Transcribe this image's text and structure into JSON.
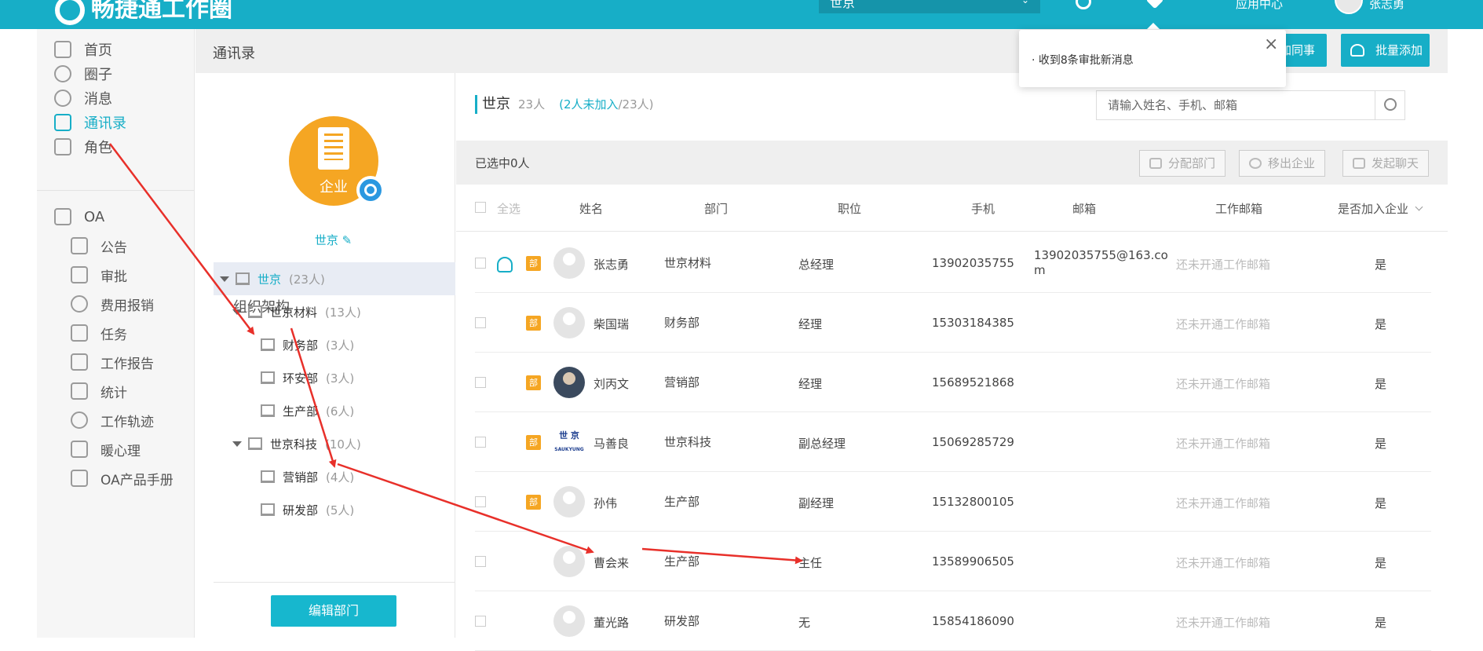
{
  "topbar": {
    "logo_text": "畅捷通工作圈",
    "select_value": "世京",
    "menu_label": "应用中心",
    "user_name": "张志勇"
  },
  "sidebar": {
    "items": [
      {
        "label": "首页"
      },
      {
        "label": "圈子"
      },
      {
        "label": "消息"
      },
      {
        "label": "通讯录"
      },
      {
        "label": "角色"
      }
    ],
    "oa_label": "OA",
    "oa_items": [
      {
        "label": "公告"
      },
      {
        "label": "审批"
      },
      {
        "label": "费用报销"
      },
      {
        "label": "任务"
      },
      {
        "label": "工作报告"
      },
      {
        "label": "统计"
      },
      {
        "label": "工作轨迹"
      },
      {
        "label": "暖心理"
      },
      {
        "label": "OA产品手册"
      }
    ]
  },
  "page": {
    "title": "通讯录"
  },
  "buttons": {
    "add_colleague": "加同事",
    "batch_add": "批量添加"
  },
  "notification": {
    "text": "· 收到8条审批新消息",
    "close": "×"
  },
  "org": {
    "logo_label": "企业",
    "company_name": "世京",
    "section_title": "组织架构",
    "tree": [
      {
        "label": "世京",
        "count": "(23人)"
      },
      {
        "label": "世京材料",
        "count": "(13人)"
      },
      {
        "label": "财务部",
        "count": "(3人)"
      },
      {
        "label": "环安部",
        "count": "(3人)"
      },
      {
        "label": "生产部",
        "count": "(6人)"
      },
      {
        "label": "世京科技",
        "count": "(10人)"
      },
      {
        "label": "营销部",
        "count": "(4人)"
      },
      {
        "label": "研发部",
        "count": "(5人)"
      }
    ],
    "edit_button": "编辑部门"
  },
  "list": {
    "company": "世京",
    "member_count": "23人",
    "not_joined": "(2人未加入",
    "total": "/23人)",
    "search_placeholder": "请输入姓名、手机、邮箱",
    "selected": "已选中0人",
    "actions": {
      "assign": "分配部门",
      "remove": "移出企业",
      "chat": "发起聊天"
    },
    "headers": {
      "select_all": "全选",
      "name": "姓名",
      "dept": "部门",
      "position": "职位",
      "phone": "手机",
      "email": "邮箱",
      "work_email": "工作邮箱",
      "joined": "是否加入企业"
    },
    "dept_badge": "部",
    "rows": [
      {
        "name": "张志勇",
        "dept": "世京材料",
        "position": "总经理",
        "phone": "13902035755",
        "email": "13902035755@163.co",
        "email2": "m",
        "work_email": "还未开通工作邮箱",
        "joined": "是"
      },
      {
        "name": "柴国瑞",
        "dept": "财务部",
        "position": "经理",
        "phone": "15303184385",
        "email": "",
        "email2": "",
        "work_email": "还未开通工作邮箱",
        "joined": "是"
      },
      {
        "name": "刘丙文",
        "dept": "营销部",
        "position": "经理",
        "phone": "15689521868",
        "email": "",
        "email2": "",
        "work_email": "还未开通工作邮箱",
        "joined": "是"
      },
      {
        "name": "马善良",
        "dept": "世京科技",
        "position": "副总经理",
        "phone": "15069285729",
        "email": "",
        "email2": "",
        "work_email": "还未开通工作邮箱",
        "joined": "是"
      },
      {
        "name": "孙伟",
        "dept": "生产部",
        "position": "副经理",
        "phone": "15132800105",
        "email": "",
        "email2": "",
        "work_email": "还未开通工作邮箱",
        "joined": "是"
      },
      {
        "name": "曹会来",
        "dept": "生产部",
        "position": "主任",
        "phone": "13589906505",
        "email": "",
        "email2": "",
        "work_email": "还未开通工作邮箱",
        "joined": "是"
      },
      {
        "name": "董光路",
        "dept": "研发部",
        "position": "无",
        "phone": "15854186090",
        "email": "",
        "email2": "",
        "work_email": "还未开通工作邮箱",
        "joined": "是"
      }
    ],
    "brand_avatar": "世 京",
    "brand_avatar_sub": "SAUKYUNG"
  },
  "colors": {
    "accent": "#17aec7",
    "badge": "#f5a623",
    "arrow": "#e8302a"
  }
}
